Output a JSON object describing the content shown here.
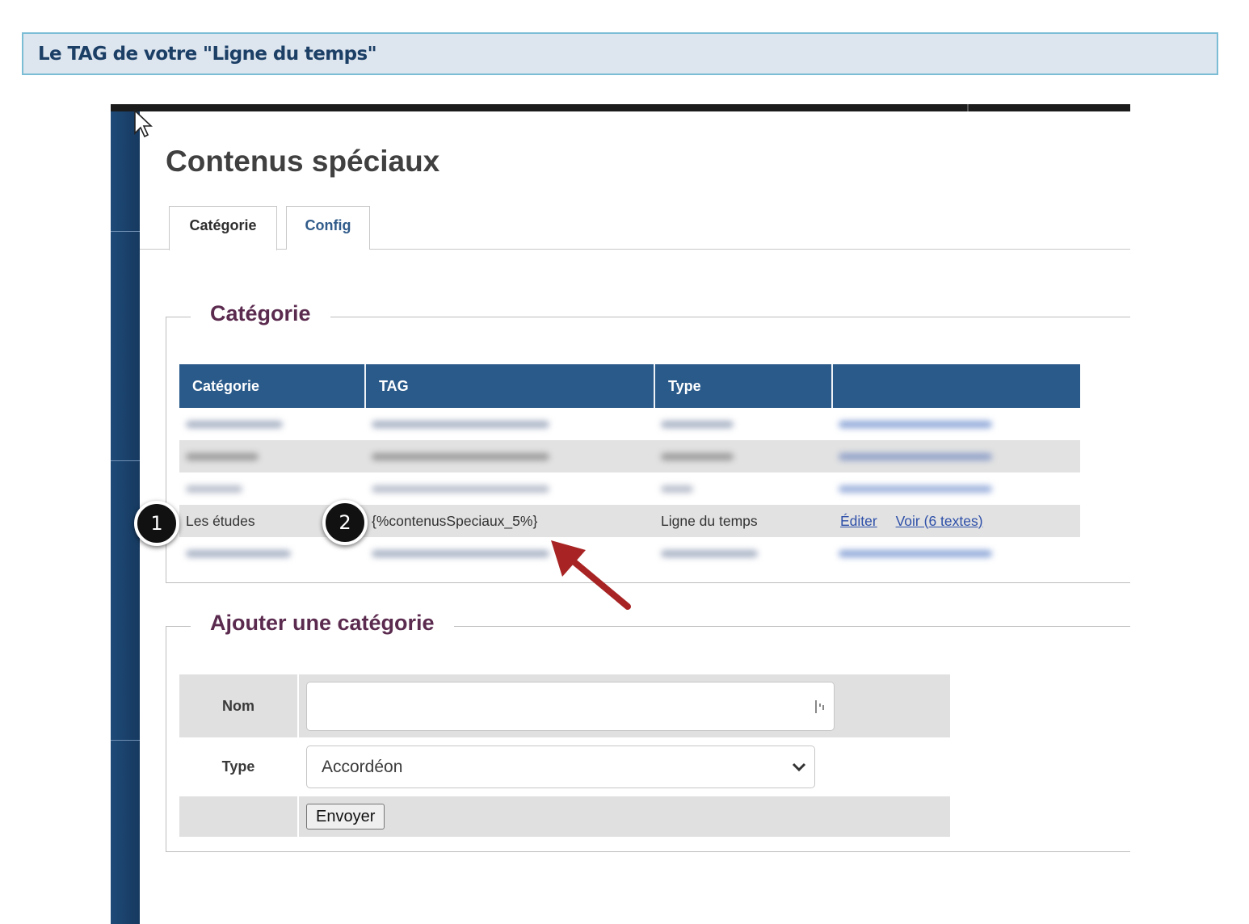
{
  "banner": {
    "title": "Le TAG de votre \"Ligne du temps\""
  },
  "page": {
    "title": "Contenus spéciaux"
  },
  "tabs": [
    {
      "label": "Catégorie",
      "active": true
    },
    {
      "label": "Config",
      "active": false
    }
  ],
  "category_section": {
    "legend": "Catégorie",
    "columns": [
      "Catégorie",
      "TAG",
      "Type",
      ""
    ],
    "visible_row": {
      "category": "Les études",
      "tag": "{%contenusSpeciaux_5%}",
      "type": "Ligne du temps",
      "edit_link": "Éditer",
      "view_link": "Voir (6 textes)"
    }
  },
  "callouts": {
    "one": "1",
    "two": "2"
  },
  "add_section": {
    "legend": "Ajouter une catégorie",
    "name_label": "Nom",
    "name_value": "",
    "type_label": "Type",
    "type_selected": "Accordéon",
    "submit_label": "Envoyer"
  },
  "colors": {
    "header": "#2a5a8a",
    "legend": "#5b2b4f",
    "sidebar": "#1e4a78",
    "arrow": "#a82424"
  }
}
